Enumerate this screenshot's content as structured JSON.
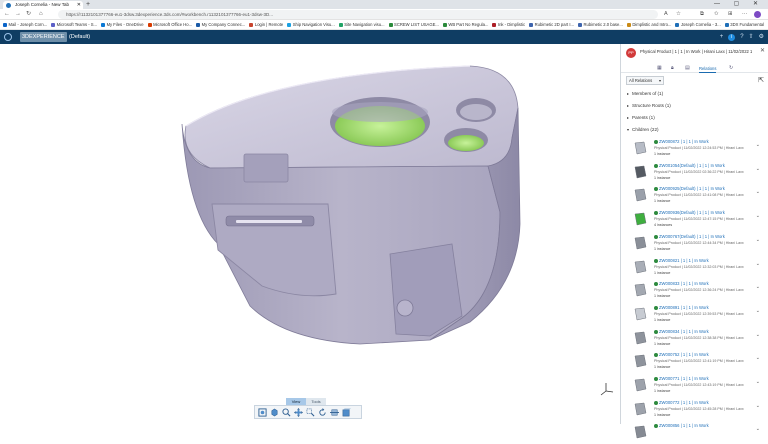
{
  "browser": {
    "tab_title": "Joseph Cornelia - New Tab",
    "new_tab": "+",
    "window_controls": "— ▢ ✕",
    "url": "https://r1132101377766-eu1-3dsw.3dexperience.3ds.com/#workbench.r1132101377766-eu1-3dsw-3D...",
    "bookmarks": [
      {
        "label": "Mail - Joseph Corn...",
        "color": "#0a64c8"
      },
      {
        "label": "Microsoft Teams - S...",
        "color": "#5b5fc7"
      },
      {
        "label": "My Files - OneDrive",
        "color": "#0a78d4"
      },
      {
        "label": "Microsoft Office Ho...",
        "color": "#d83b01"
      },
      {
        "label": "My Company Connec...",
        "color": "#1b5aa7"
      },
      {
        "label": "Login | Remote",
        "color": "#c8442d"
      },
      {
        "label": "Ship Navigation Visu...",
        "color": "#1aa1e2"
      },
      {
        "label": "Site Navigation visu...",
        "color": "#21a366"
      },
      {
        "label": "SCREW LIST USAGE...",
        "color": "#2a8a3a"
      },
      {
        "label": "WB Part No Regula...",
        "color": "#2a8a3a"
      },
      {
        "label": "Ink - Dimplistic",
        "color": "#ad1f27"
      },
      {
        "label": "Rubimetic 2D part I...",
        "color": "#3e64ad"
      },
      {
        "label": "Rubimetic 2.0 base...",
        "color": "#3e64ad"
      },
      {
        "label": "Dimplistic and Intro...",
        "color": "#c98a16"
      },
      {
        "label": "Joseph Cornelia - 3...",
        "color": "#1f6fb8"
      },
      {
        "label": "3DX Fundamental",
        "color": "#1f6fb8"
      },
      {
        "label": "Long lead items co...",
        "color": "#1f6fb8"
      }
    ]
  },
  "app": {
    "brand_pill": "3DEXPERIENCE",
    "brand_context": "(Default)",
    "info": "i",
    "icons": [
      "help-icon",
      "share-icon",
      "settings-icon"
    ]
  },
  "viewport": {
    "tab_view": "View",
    "tab_tools": "Tools",
    "tools": [
      "fit-all-icon",
      "view-orientation-icon",
      "zoom-icon",
      "pan-icon",
      "zoom-area-icon",
      "rotate-icon",
      "section-icon",
      "render-style-icon"
    ]
  },
  "panel": {
    "avatar": "PP",
    "title": "Physical Product | 1 | 1 | In Work | Hirani Laxx | 11/02/2022 12:26:05 PM",
    "tabs": {
      "relations": "Relations"
    },
    "dropdown": "All Relations",
    "sections": [
      {
        "label": "Members of (1)",
        "arrow": "▸"
      },
      {
        "label": "Structure Roots (1)",
        "arrow": "▸"
      },
      {
        "label": "Parents (1)",
        "arrow": "▸"
      },
      {
        "label": "Children (22)",
        "arrow": "▾"
      }
    ],
    "children": [
      {
        "name": "ZW000872 | 1 | 1 | In Work",
        "date": "Physical Product | 11/02/2022 12:24:53 PM | Hirani Laxx",
        "count": "1 instance",
        "thumb": "#b7bcc6"
      },
      {
        "name": "ZW001054(Default) | 1 | 1 | In Work",
        "date": "Physical Product | 11/02/2022 02:36:22 PM | Hirani Laxx",
        "count": "1 instance",
        "thumb": "#555a62"
      },
      {
        "name": "ZW000925(Default) | 1 | 1 | In Work",
        "date": "Physical Product | 11/02/2022 12:41:08 PM | Hirani Laxx",
        "count": "1 instance",
        "thumb": "#9aa0aa"
      },
      {
        "name": "ZW000936(Default) | 1 | 1 | In Work",
        "date": "Physical Product | 11/02/2022 12:47:15 PM | Hirani Laxx",
        "count": "4 instances",
        "thumb": "#3fae3f"
      },
      {
        "name": "ZW000767(Default) | 1 | 1 | In Work",
        "date": "Physical Product | 11/02/2022 12:44:34 PM | Hirani Laxx",
        "count": "1 instance",
        "thumb": "#8a8f98"
      },
      {
        "name": "ZW000821 | 1 | 1 | In Work",
        "date": "Physical Product | 11/02/2022 12:32:03 PM | Hirani Laxx",
        "count": "1 instance",
        "thumb": "#a9aeb7"
      },
      {
        "name": "ZW000833 | 1 | 1 | In Work",
        "date": "Physical Product | 11/02/2022 12:36:24 PM | Hirani Laxx",
        "count": "1 instance",
        "thumb": "#a3a8b1"
      },
      {
        "name": "ZW000891 | 1 | 1 | In Work",
        "date": "Physical Product | 11/02/2022 12:39:53 PM | Hirani Laxx",
        "count": "1 instance",
        "thumb": "#c7cbd2"
      },
      {
        "name": "ZW000834 | 1 | 1 | In Work",
        "date": "Physical Product | 11/02/2022 12:38:38 PM | Hirani Laxx",
        "count": "1 instance",
        "thumb": "#8e939c"
      },
      {
        "name": "ZW000752 | 1 | 1 | In Work",
        "date": "Physical Product | 11/02/2022 12:41:19 PM | Hirani Laxx",
        "count": "1 instance",
        "thumb": "#8e939c"
      },
      {
        "name": "ZW000771 | 1 | 1 | In Work",
        "date": "Physical Product | 11/02/2022 12:43:19 PM | Hirani Laxx",
        "count": "1 instance",
        "thumb": "#9da2ab"
      },
      {
        "name": "ZW000772 | 1 | 1 | In Work",
        "date": "Physical Product | 11/02/2022 12:45:28 PM | Hirani Laxx",
        "count": "1 instance",
        "thumb": "#9da2ab"
      },
      {
        "name": "ZW000856 | 1 | 1 | In Work",
        "date": "",
        "count": "",
        "thumb": "#858a93"
      }
    ]
  }
}
